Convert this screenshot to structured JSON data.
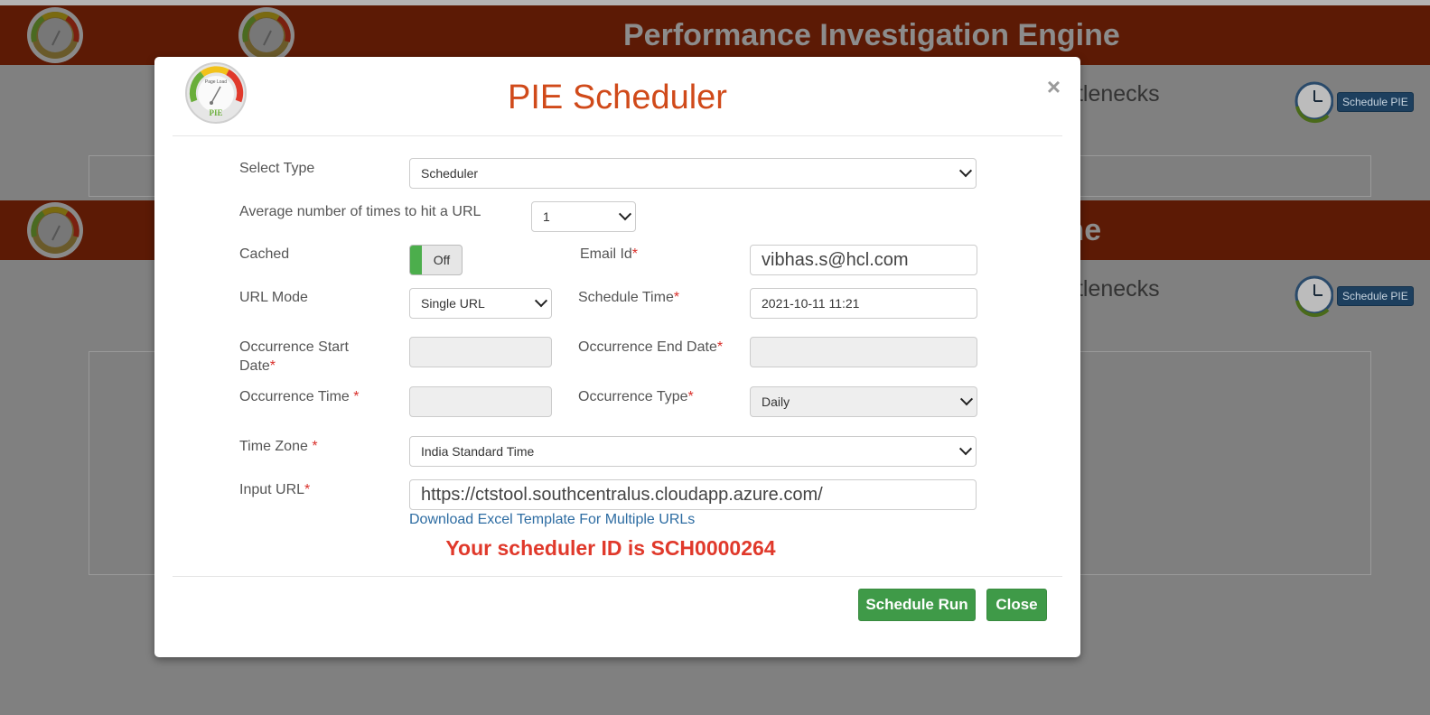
{
  "background": {
    "banner_title": "Performance Investigation Engine",
    "banner_title_2": "ine",
    "subtitle_fragment": "ttlenecks",
    "schedule_button": "Schedule PIE",
    "logo_text": "PIE",
    "logo_caption": "Page Load"
  },
  "modal": {
    "title": "PIE Scheduler",
    "close_symbol": "×",
    "logo_text": "PIE",
    "logo_caption": "Page Load"
  },
  "form": {
    "select_type": {
      "label": "Select Type",
      "value": "Scheduler"
    },
    "hits": {
      "label": "Average number of times to hit a URL",
      "value": "1"
    },
    "cached": {
      "label": "Cached",
      "toggle_text": "Off"
    },
    "email": {
      "label": "Email Id",
      "required": "*",
      "value": "vibhas.s@hcl.com"
    },
    "url_mode": {
      "label": "URL Mode",
      "value": "Single URL"
    },
    "schedule_time": {
      "label": "Schedule Time",
      "required": "*",
      "value": "2021-10-11 11:21"
    },
    "occ_start": {
      "label_line1": "Occurrence Start",
      "label_line2": "Date",
      "required": "*",
      "value": ""
    },
    "occ_end": {
      "label": "Occurrence End Date",
      "required": "*",
      "value": ""
    },
    "occ_time": {
      "label": "Occurrence Time ",
      "required": "*",
      "value": ""
    },
    "occ_type": {
      "label": "Occurrence Type",
      "required": "*",
      "value": "Daily"
    },
    "time_zone": {
      "label": "Time Zone ",
      "required": "*",
      "value": "India Standard Time"
    },
    "input_url": {
      "label": "Input URL",
      "required": "*",
      "value": "https://ctstool.southcentralus.cloudapp.azure.com/"
    },
    "download_link": "Download Excel Template For Multiple URLs",
    "result_message": "Your scheduler ID is SCH0000264"
  },
  "footer": {
    "schedule_run": "Schedule Run",
    "close": "Close"
  },
  "colors": {
    "banner": "#5c1a05",
    "title": "#d04a1a",
    "button": "#3f9a48",
    "error": "#e0392b",
    "link": "#2d6ca2"
  }
}
